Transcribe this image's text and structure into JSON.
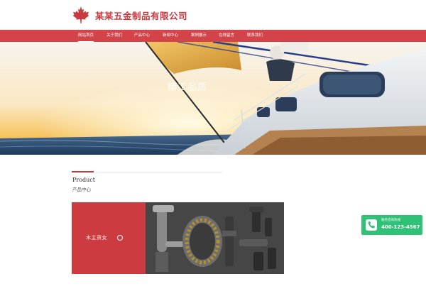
{
  "header": {
    "company_name": "某某五金制品有限公司",
    "logo_icon": "maple-leaf-icon",
    "brand_color": "#c93a3e"
  },
  "nav": {
    "items": [
      {
        "label": "网站首页",
        "active": true
      },
      {
        "label": "关于我们"
      },
      {
        "label": "产品中心"
      },
      {
        "label": "新闻中心"
      },
      {
        "label": "案例展示"
      },
      {
        "label": "在线留言"
      },
      {
        "label": "联系我们"
      }
    ],
    "background": "#d2444a"
  },
  "banner": {
    "caption": "精工品质"
  },
  "section": {
    "title_en": "Product",
    "title_zh": "产品中心"
  },
  "products": {
    "category_label": "木主货女"
  },
  "hotline": {
    "label": "服务咨询热线",
    "number": "400-123-4567",
    "icon": "phone-icon",
    "color": "#2fc176"
  }
}
